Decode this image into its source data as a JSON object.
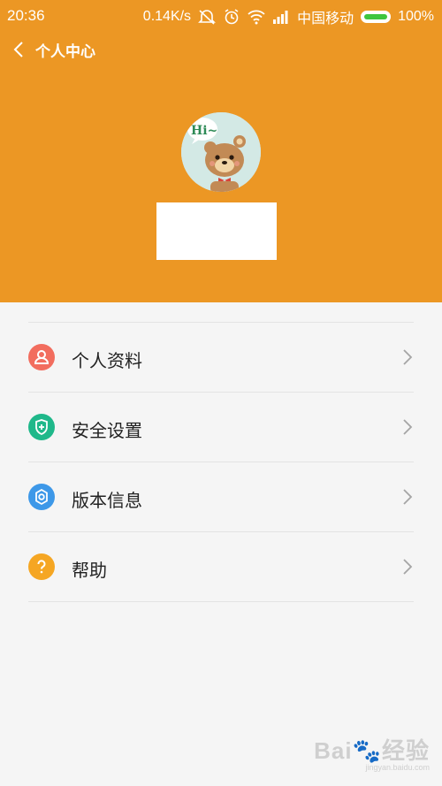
{
  "status_bar": {
    "time": "20:36",
    "speed": "0.14K/s",
    "carrier": "中国移动",
    "battery_percent": "100%",
    "battery_level": 1.0
  },
  "title_bar": {
    "title": "个人中心"
  },
  "profile": {
    "avatar_icon": "bear-hi-avatar-icon",
    "avatar_text": "Hi~"
  },
  "menu": {
    "items": [
      {
        "label": "个人资料",
        "icon": "person-icon",
        "color": "#f26d5e"
      },
      {
        "label": "安全设置",
        "icon": "shield-plus-icon",
        "color": "#1fb88a"
      },
      {
        "label": "版本信息",
        "icon": "gear-icon",
        "color": "#3d98e8"
      },
      {
        "label": "帮助",
        "icon": "question-icon",
        "color": "#f5a623"
      }
    ]
  },
  "colors": {
    "header": "#ec9724",
    "background": "#f5f5f5"
  },
  "watermark": {
    "main": "Bai🐾经验",
    "sub": "jingyan.baidu.com"
  }
}
